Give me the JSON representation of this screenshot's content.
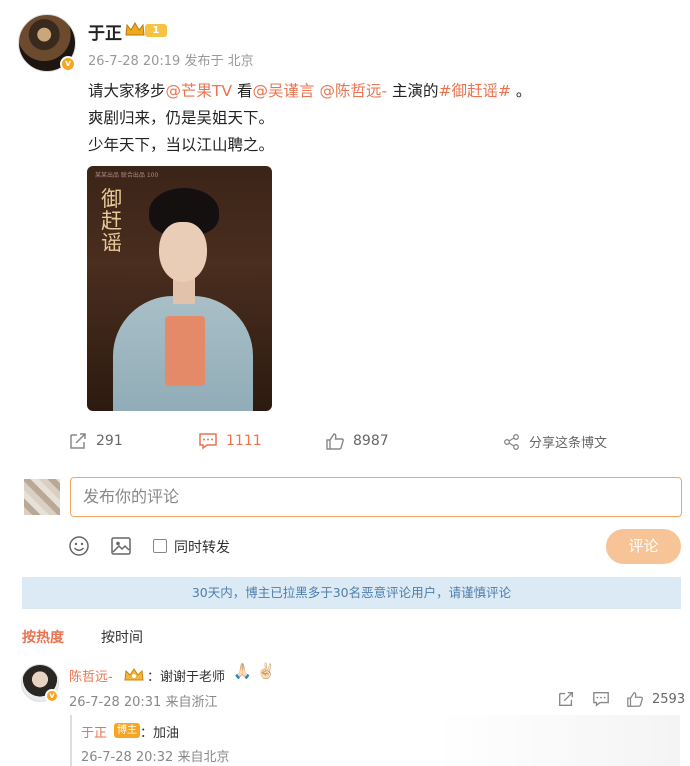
{
  "post": {
    "author": "于正",
    "level": "1",
    "verified_badge": "v",
    "timestamp": "26-7-28 20:19",
    "source": "发布于 北京",
    "line1_prefix": "请大家移步",
    "mention_mango": "@芒果TV",
    "line1_mid": " 看",
    "mention_wu": "@吴谨言",
    "mention_chen": "@陈哲远-",
    "line1_suffix": " 主演的",
    "hashtag": "#御赶谣#",
    "line1_end": " 。",
    "line2": "爽剧归来，仍是吴姐天下。",
    "line3": "少年天下，当以江山聘之。",
    "poster": {
      "title": "御赶谣",
      "top_strip": "某某出品 联合出品 100"
    }
  },
  "actions": {
    "repost_count": "291",
    "comment_count": "1111",
    "like_count": "8987",
    "share_label": "分享这条博文"
  },
  "composer": {
    "placeholder": "发布你的评论",
    "repost_label": "同时转发",
    "submit_label": "评论"
  },
  "notice": "30天内，博主已拉黑多于30名恶意评论用户，请谨慎评论",
  "sort": {
    "hot": "按热度",
    "time": "按时间"
  },
  "comments": [
    {
      "author": "陈哲远-",
      "text": "：谢谢于老师",
      "emoji": "🙏🏻 ✌🏻",
      "time": "26-7-28 20:31",
      "location": "来自浙江",
      "likes": "2593",
      "reply": {
        "author": "于正",
        "badge": "博主",
        "text": "：加油",
        "time": "26-7-28 20:32",
        "location": "来自北京"
      }
    }
  ],
  "colors": {
    "accent": "#eb7350",
    "notice_bg": "#dceaf6",
    "notice_text": "#4e7dab",
    "submit_bg": "#f7c497"
  }
}
